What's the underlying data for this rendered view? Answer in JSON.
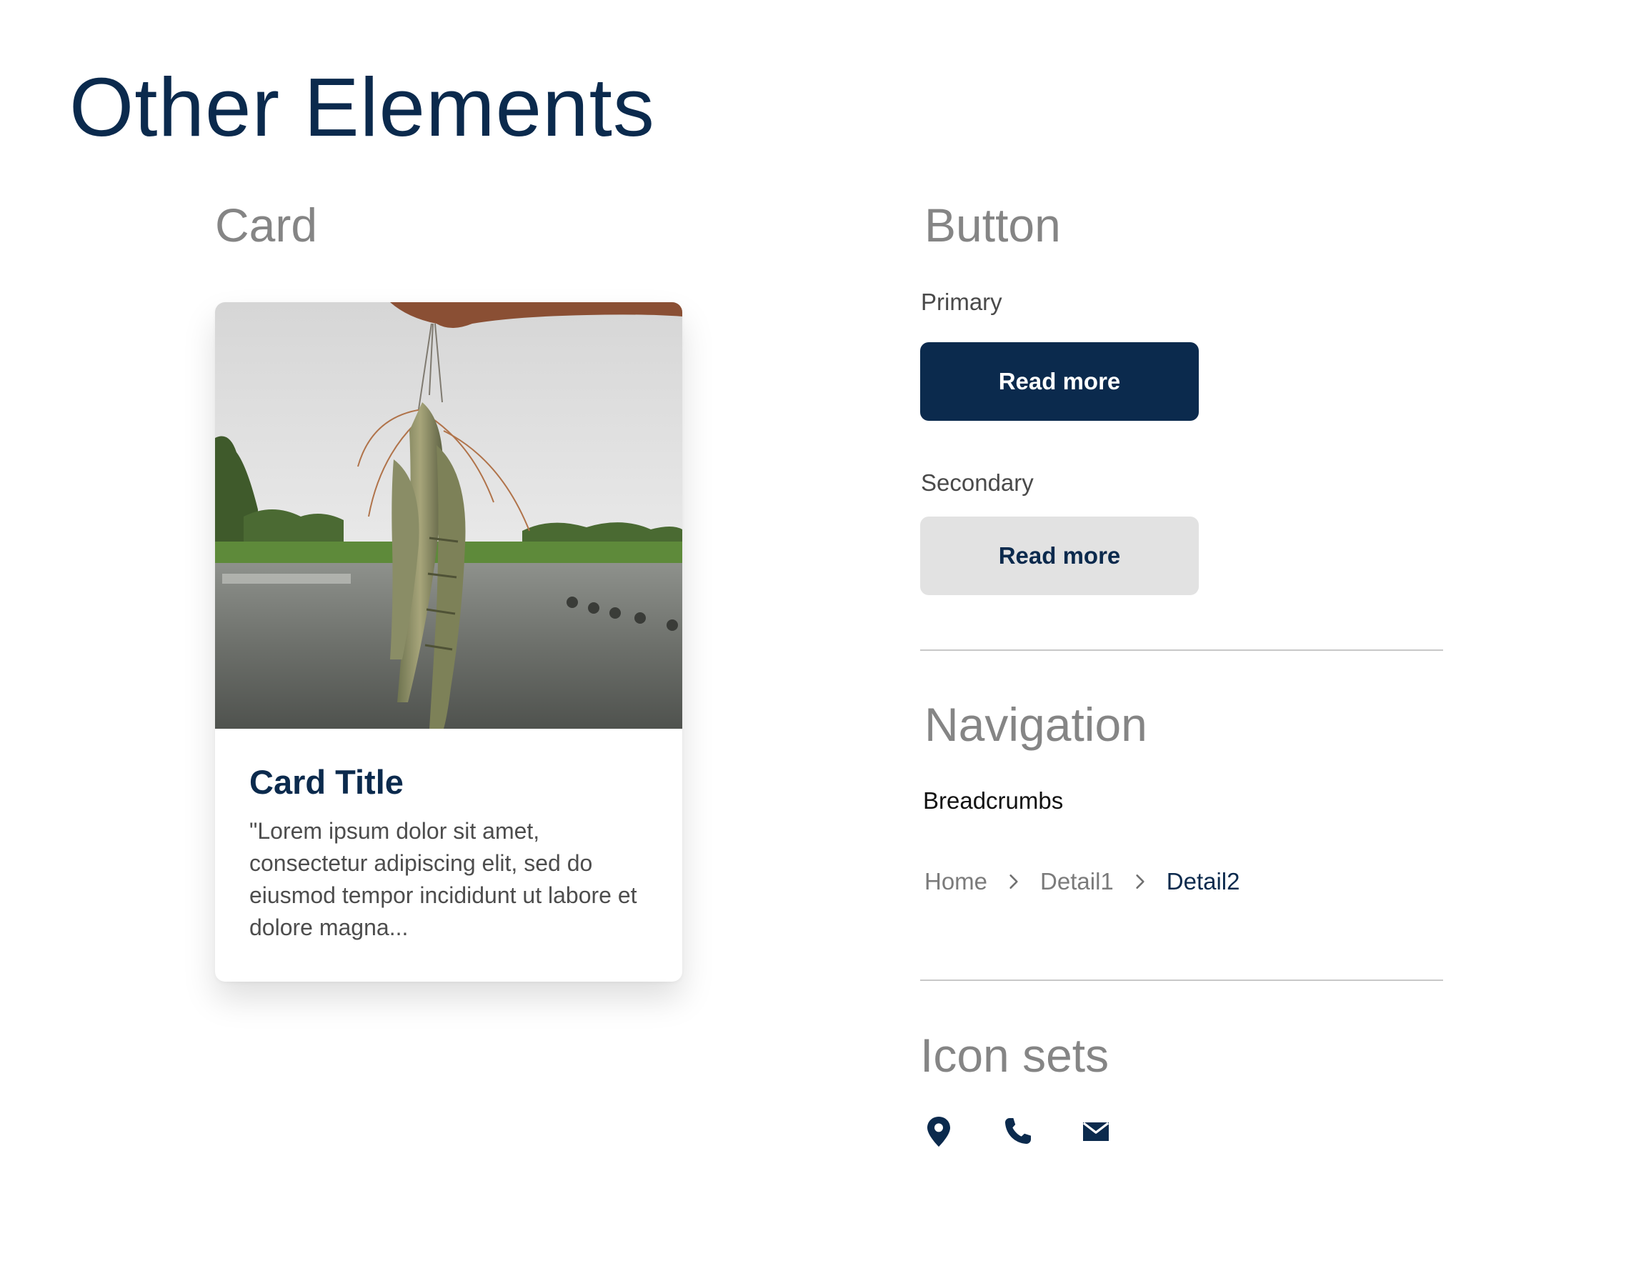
{
  "page": {
    "title": "Other Elements"
  },
  "card_section": {
    "heading": "Card",
    "card": {
      "title": "Card Title",
      "text": "\"Lorem ipsum dolor sit amet, consectetur adipiscing elit, sed do eiusmod tempor incididunt ut labore et dolore magna...",
      "image": "shrimp-held-over-pond-photo"
    }
  },
  "button_section": {
    "heading": "Button",
    "primary": {
      "label": "Primary",
      "button_text": "Read more"
    },
    "secondary": {
      "label": "Secondary",
      "button_text": "Read more"
    }
  },
  "navigation_section": {
    "heading": "Navigation",
    "breadcrumbs_label": "Breadcrumbs",
    "breadcrumbs": [
      "Home",
      "Detail1",
      "Detail2"
    ],
    "separator_icon": "chevron-right-icon"
  },
  "icon_section": {
    "heading": "Icon sets",
    "icons": [
      "location-pin-icon",
      "phone-icon",
      "mail-icon"
    ]
  },
  "colors": {
    "brand_navy": "#0b2a4d",
    "heading_gray": "#858585",
    "secondary_button_bg": "#e2e2e2",
    "divider": "#c8c8c8"
  }
}
